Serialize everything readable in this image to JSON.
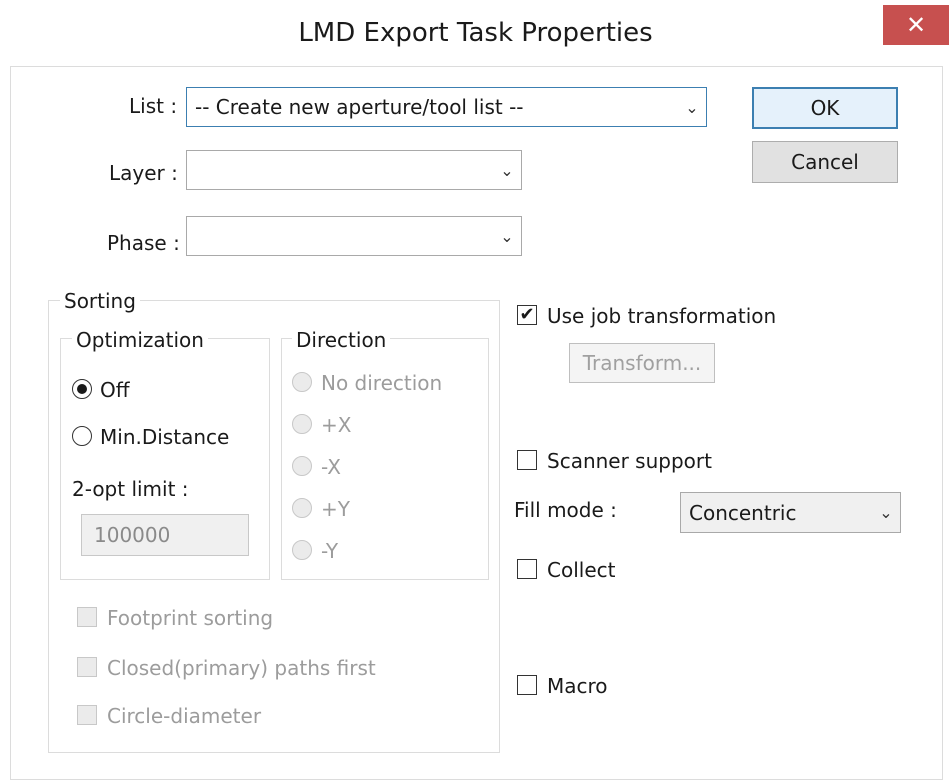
{
  "window": {
    "title": "LMD Export Task Properties",
    "close_glyph": "✕"
  },
  "fields": {
    "list_label": "List :",
    "list_value": "-- Create new aperture/tool list --",
    "layer_label": "Layer :",
    "layer_value": "",
    "phase_label": "Phase :",
    "phase_value": ""
  },
  "buttons": {
    "ok": "OK",
    "cancel": "Cancel",
    "transform": "Transform..."
  },
  "sorting": {
    "title": "Sorting",
    "optimization": {
      "title": "Optimization",
      "off": "Off",
      "min_distance": "Min.Distance",
      "selected": "Off",
      "two_opt_label": "2-opt limit :",
      "two_opt_value": "100000"
    },
    "direction": {
      "title": "Direction",
      "options": [
        "No direction",
        "+X",
        "-X",
        "+Y",
        "-Y"
      ]
    },
    "footprint_sorting": "Footprint sorting",
    "closed_paths_first": "Closed(primary) paths first",
    "circle_diameter": "Circle-diameter"
  },
  "options": {
    "use_job_transformation": "Use job transformation",
    "use_job_transformation_checked": true,
    "scanner_support": "Scanner support",
    "fill_mode_label": "Fill mode :",
    "fill_mode_value": "Concentric",
    "collect": "Collect",
    "macro": "Macro"
  },
  "icons": {
    "chevron": "chevron-down-icon",
    "check": "checkmark-icon",
    "close": "close-icon"
  },
  "colors": {
    "close_button": "#c7504f",
    "focus_border": "#3c7fb1",
    "disabled_text": "#9c9c9c"
  }
}
